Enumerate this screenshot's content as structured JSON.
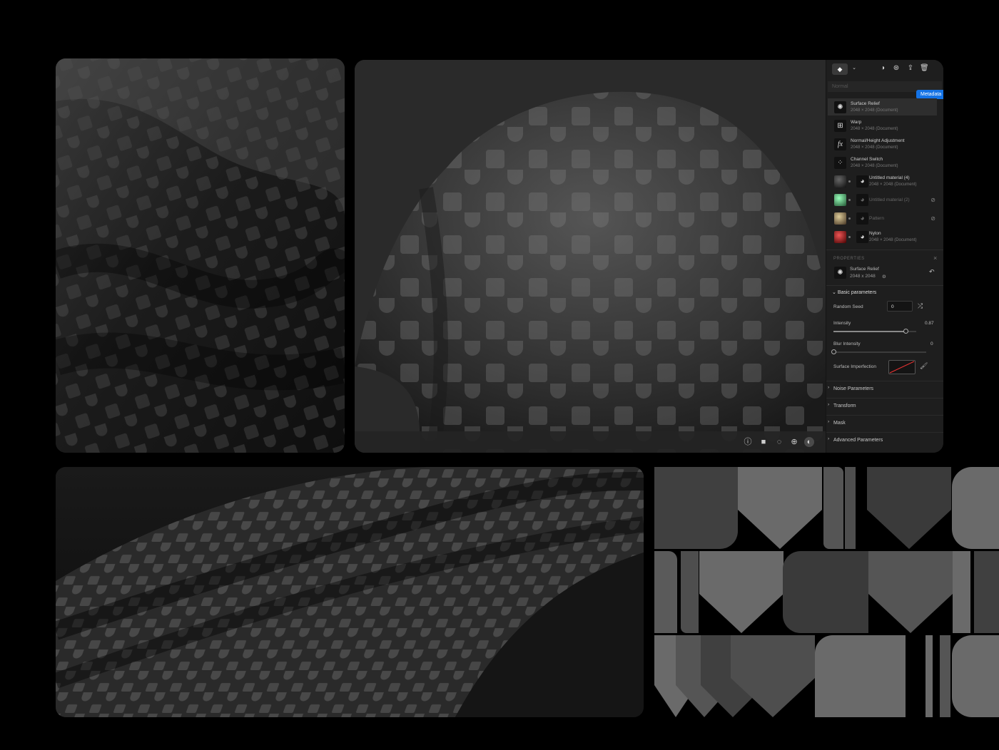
{
  "panel": {
    "metadata_label": "Metadata",
    "blend_mode": "Normal",
    "layers": [
      {
        "name": "Surface Relief",
        "size": "2048 × 2048 (Document)",
        "icon": "relief-icon",
        "selected": true
      },
      {
        "name": "Warp",
        "size": "2048 × 2048 (Document)",
        "icon": "warp-icon"
      },
      {
        "name": "Normal/Height Adjustment",
        "size": "2048 × 2048 (Document)",
        "icon": "fx-icon"
      },
      {
        "name": "Channel Switch",
        "size": "2048 × 2048 (Document)",
        "icon": "channel-switch-icon"
      },
      {
        "name": "Untitled material (4)",
        "size": "2048 × 2048 (Document)",
        "icon": "material-icon"
      },
      {
        "name": "Untitled material (2)",
        "size": "",
        "icon": "material-icon",
        "hidden": true
      },
      {
        "name": "Pattern",
        "size": "",
        "icon": "material-icon",
        "hidden": true
      },
      {
        "name": "Nylon",
        "size": "2048 × 2048 (Document)",
        "icon": "material-icon"
      }
    ],
    "properties": {
      "header": "PROPERTIES",
      "name": "Surface Relief",
      "size": "2048 x 2048",
      "basic_label": "Basic parameters",
      "random_seed_label": "Random Seed",
      "random_seed": "0",
      "intensity_label": "Intensity",
      "intensity": "0.87",
      "intensity_fraction": 0.87,
      "blur_label": "Blur Intensity",
      "blur": "0",
      "blur_fraction": 0,
      "imperfection_label": "Surface Imperfection",
      "sections": [
        "Noise Parameters",
        "Transform",
        "Mask",
        "Advanced Parameters"
      ]
    }
  }
}
